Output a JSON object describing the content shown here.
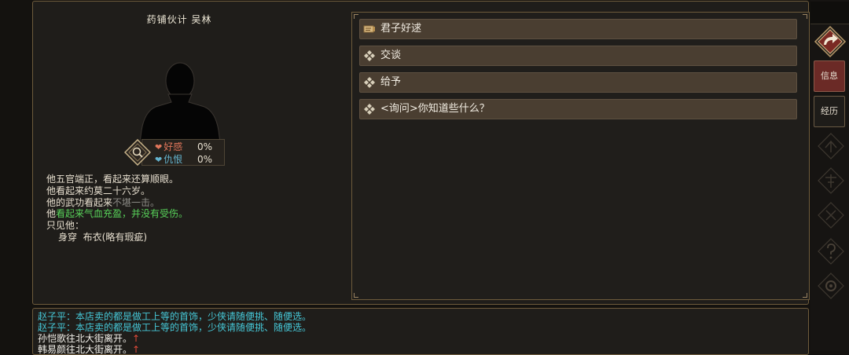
{
  "npc": {
    "title": "药铺伙计 吴林",
    "favor_label": "好感",
    "favor_value": "0%",
    "hatred_label": "仇恨",
    "hatred_value": "0%"
  },
  "description": {
    "line1": "他五官端正，看起来还算顺眼。",
    "line2": "他看起来约莫二十六岁。",
    "line3_prefix": "他的武功看起来",
    "line3_dim": "不堪一击。",
    "line4_prefix": "他",
    "line4_green": "看起来气血充盈，并没有受伤。",
    "line5": "只见他：",
    "line6_label": "身穿",
    "line6_value": "布衣(略有瑕疵)"
  },
  "dialog_options": [
    {
      "label": "君子好逑",
      "icon": "scroll-icon"
    },
    {
      "label": "交谈",
      "icon": "diamond-icon"
    },
    {
      "label": "给予",
      "icon": "diamond-icon"
    },
    {
      "label": "<询问>你知道些什么？",
      "icon": "diamond-icon"
    }
  ],
  "log": [
    {
      "text": "赵子平：本店卖的都是做工上等的首饰，少侠请随便挑、随便选。",
      "color": "#46c8d8"
    },
    {
      "text": "赵子平：本店卖的都是做工上等的首饰，少侠请随便挑、随便选。",
      "color": "#46c8d8"
    },
    {
      "text": "孙恺歌往北大街离开。",
      "arrow": "↑",
      "color": "#f2f0ea"
    },
    {
      "text": "韩易颜往北大街离开。",
      "arrow": "↑",
      "color": "#f2f0ea"
    }
  ],
  "sidebar": {
    "info_label": "信息",
    "history_label": "经历"
  },
  "colors": {
    "panel_border": "#6e5b3c",
    "option_bg": "#4a3e31",
    "active_tab": "#6b2a26",
    "green_text": "#58d35a",
    "cyan_text": "#46c8d8"
  }
}
